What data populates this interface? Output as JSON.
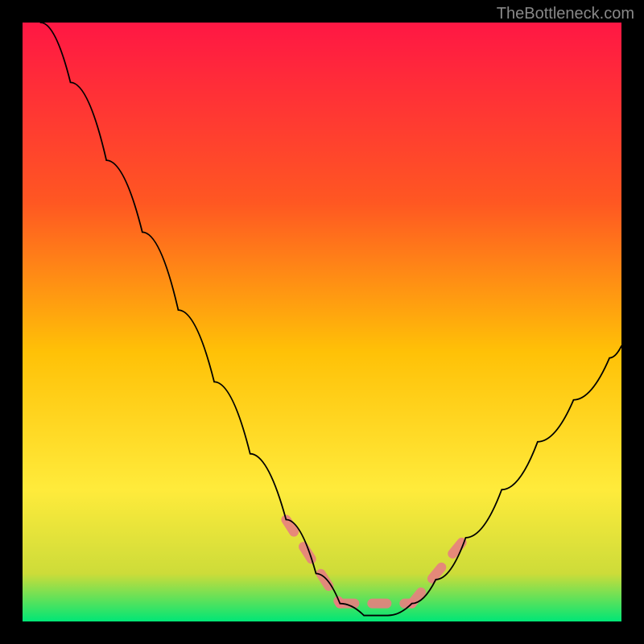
{
  "watermark": "TheBottleneck.com",
  "chart_data": {
    "type": "line",
    "title": "",
    "xlabel": "",
    "ylabel": "",
    "xlim": [
      0,
      100
    ],
    "ylim": [
      0,
      100
    ],
    "gradient_colors": {
      "top": "#ff1744",
      "upper_mid": "#ff5722",
      "mid": "#ffc107",
      "lower_mid": "#ffeb3b",
      "low": "#cddc39",
      "bottom": "#00e676"
    },
    "curve": {
      "name": "bottleneck-curve",
      "color": "#000000",
      "points": [
        {
          "x": 3,
          "y": 100
        },
        {
          "x": 8,
          "y": 90
        },
        {
          "x": 14,
          "y": 77
        },
        {
          "x": 20,
          "y": 65
        },
        {
          "x": 26,
          "y": 52
        },
        {
          "x": 32,
          "y": 40
        },
        {
          "x": 38,
          "y": 28
        },
        {
          "x": 44,
          "y": 17
        },
        {
          "x": 49,
          "y": 8
        },
        {
          "x": 53,
          "y": 3
        },
        {
          "x": 57,
          "y": 1
        },
        {
          "x": 61,
          "y": 1
        },
        {
          "x": 65,
          "y": 3
        },
        {
          "x": 69,
          "y": 7
        },
        {
          "x": 74,
          "y": 14
        },
        {
          "x": 80,
          "y": 22
        },
        {
          "x": 86,
          "y": 30
        },
        {
          "x": 92,
          "y": 37
        },
        {
          "x": 98,
          "y": 44
        },
        {
          "x": 100,
          "y": 46
        }
      ]
    },
    "marker_segments": [
      {
        "start": {
          "x": 44,
          "y": 17
        },
        "end": {
          "x": 53,
          "y": 3
        }
      },
      {
        "start": {
          "x": 53,
          "y": 3
        },
        "end": {
          "x": 65,
          "y": 3
        }
      },
      {
        "start": {
          "x": 65,
          "y": 3
        },
        "end": {
          "x": 74,
          "y": 14
        }
      }
    ],
    "marker_color": "#e88080"
  }
}
